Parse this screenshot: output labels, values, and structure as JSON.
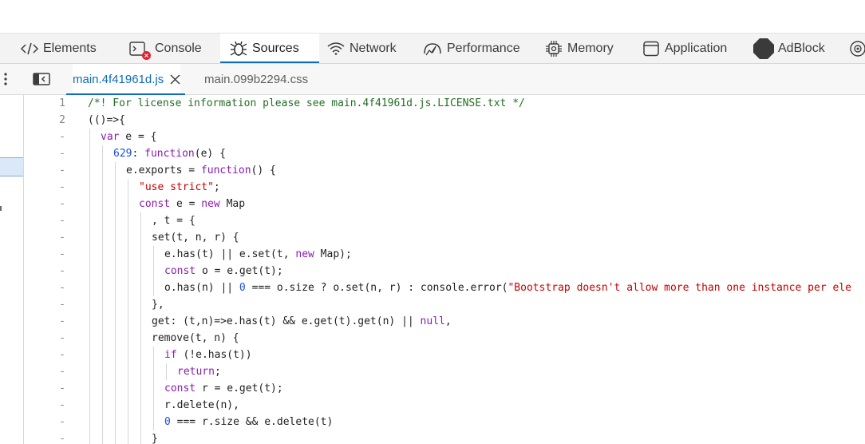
{
  "devtools": {
    "main_tabs": [
      {
        "label": "Elements",
        "icon": "code-brackets-icon"
      },
      {
        "label": "Console",
        "icon": "console-icon",
        "badge": "error-badge"
      },
      {
        "label": "Sources",
        "icon": "bug-icon",
        "active": true
      },
      {
        "label": "Network",
        "icon": "wifi-icon"
      },
      {
        "label": "Performance",
        "icon": "performance-icon"
      },
      {
        "label": "Memory",
        "icon": "memory-chip-icon"
      },
      {
        "label": "Application",
        "icon": "application-icon"
      },
      {
        "label": "AdBlock",
        "icon": "adblock-octagon-icon"
      }
    ],
    "accent_color": "#0f6cbd",
    "error_badge_color": "#e0242f"
  },
  "sources": {
    "file_tabs": [
      {
        "label": "main.4f41961d.js",
        "active": true
      },
      {
        "label": "main.099b2294.css",
        "active": false
      }
    ],
    "lines": [
      {
        "num": "1",
        "indent": 0,
        "tokens": [
          {
            "t": "/*! For license information please see main.4f41961d.js.LICENSE.txt */",
            "c": "comment"
          }
        ]
      },
      {
        "num": "2",
        "indent": 0,
        "tokens": [
          {
            "t": "(()=>{",
            "c": "plain"
          }
        ]
      },
      {
        "num": "-",
        "indent": 1,
        "tokens": [
          {
            "t": "var",
            "c": "keyword"
          },
          {
            "t": " e = {",
            "c": "plain"
          }
        ]
      },
      {
        "num": "-",
        "indent": 2,
        "tokens": [
          {
            "t": "629",
            "c": "number"
          },
          {
            "t": ": ",
            "c": "plain"
          },
          {
            "t": "function",
            "c": "keyword"
          },
          {
            "t": "(e) {",
            "c": "plain"
          }
        ]
      },
      {
        "num": "-",
        "indent": 3,
        "tokens": [
          {
            "t": "e.exports = ",
            "c": "plain"
          },
          {
            "t": "function",
            "c": "keyword"
          },
          {
            "t": "() {",
            "c": "plain"
          }
        ]
      },
      {
        "num": "-",
        "indent": 4,
        "tokens": [
          {
            "t": "\"use strict\"",
            "c": "string"
          },
          {
            "t": ";",
            "c": "plain"
          }
        ]
      },
      {
        "num": "-",
        "indent": 4,
        "tokens": [
          {
            "t": "const",
            "c": "keyword"
          },
          {
            "t": " e = ",
            "c": "plain"
          },
          {
            "t": "new",
            "c": "keyword"
          },
          {
            "t": " Map",
            "c": "plain"
          }
        ]
      },
      {
        "num": "-",
        "indent": 5,
        "tokens": [
          {
            "t": ", t = {",
            "c": "plain"
          }
        ]
      },
      {
        "num": "-",
        "indent": 5,
        "tokens": [
          {
            "t": "set(t, n, r) {",
            "c": "plain"
          }
        ]
      },
      {
        "num": "-",
        "indent": 6,
        "tokens": [
          {
            "t": "e.has(t) || e.set(t, ",
            "c": "plain"
          },
          {
            "t": "new",
            "c": "keyword"
          },
          {
            "t": " Map);",
            "c": "plain"
          }
        ]
      },
      {
        "num": "-",
        "indent": 6,
        "tokens": [
          {
            "t": "const",
            "c": "keyword"
          },
          {
            "t": " o = e.get(t);",
            "c": "plain"
          }
        ]
      },
      {
        "num": "-",
        "indent": 6,
        "tokens": [
          {
            "t": "o.has(n) || ",
            "c": "plain"
          },
          {
            "t": "0",
            "c": "number"
          },
          {
            "t": " === o.size ? o.set(n, r) : console.error(",
            "c": "plain"
          },
          {
            "t": "\"Bootstrap doesn't allow more than one instance per ele",
            "c": "string"
          }
        ]
      },
      {
        "num": "-",
        "indent": 5,
        "tokens": [
          {
            "t": "},",
            "c": "plain"
          }
        ]
      },
      {
        "num": "-",
        "indent": 5,
        "tokens": [
          {
            "t": "get: (t,n)=>e.has(t) && e.get(t).get(n) || ",
            "c": "plain"
          },
          {
            "t": "null",
            "c": "keyword"
          },
          {
            "t": ",",
            "c": "plain"
          }
        ]
      },
      {
        "num": "-",
        "indent": 5,
        "tokens": [
          {
            "t": "remove(t, n) {",
            "c": "plain"
          }
        ]
      },
      {
        "num": "-",
        "indent": 6,
        "tokens": [
          {
            "t": "if",
            "c": "keyword"
          },
          {
            "t": " (!e.has(t))",
            "c": "plain"
          }
        ]
      },
      {
        "num": "-",
        "indent": 7,
        "tokens": [
          {
            "t": "return",
            "c": "keyword"
          },
          {
            "t": ";",
            "c": "plain"
          }
        ]
      },
      {
        "num": "-",
        "indent": 6,
        "tokens": [
          {
            "t": "const",
            "c": "keyword"
          },
          {
            "t": " r = e.get(t);",
            "c": "plain"
          }
        ]
      },
      {
        "num": "-",
        "indent": 6,
        "tokens": [
          {
            "t": "r.delete(n),",
            "c": "plain"
          }
        ]
      },
      {
        "num": "-",
        "indent": 6,
        "tokens": [
          {
            "t": "0",
            "c": "number"
          },
          {
            "t": " === r.size && e.delete(t)",
            "c": "plain"
          }
        ]
      },
      {
        "num": "-",
        "indent": 5,
        "tokens": [
          {
            "t": "}",
            "c": "plain"
          }
        ]
      }
    ]
  }
}
